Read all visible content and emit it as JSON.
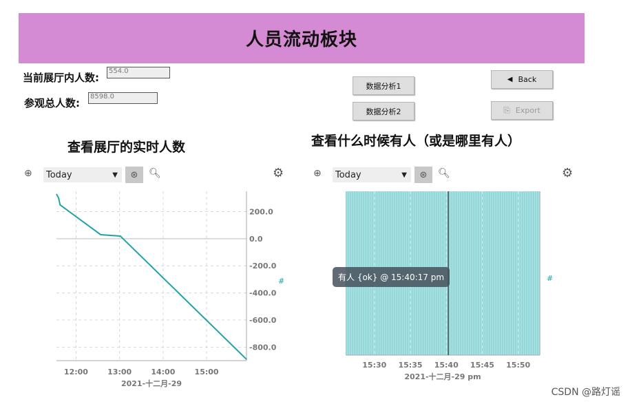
{
  "header": {
    "title": "人员流动板块"
  },
  "fields": {
    "current_label": "当前展厅内人数:",
    "current_value": "554.0",
    "total_label": "参观总人数:",
    "total_value": "8598.0"
  },
  "buttons": {
    "analysis1": "数据分析1",
    "analysis2": "数据分析2",
    "back": "Back",
    "export": "Export"
  },
  "left_panel": {
    "title": "查看展厅的实时人数",
    "range_select": "Today",
    "axis_unit": "#"
  },
  "right_panel": {
    "title": "查看什么时候有人（或是哪里有人）",
    "range_select": "Today",
    "axis_unit": "#",
    "tooltip": "有人 {ok} @ 15:40:17 pm"
  },
  "colors": {
    "banner": "#d58bd4",
    "series": "#1fa3a8",
    "strip_light": "#a9e1e2",
    "strip_dark": "#6fc9cc"
  },
  "watermark": "CSDN @路灯谣",
  "chart_data": [
    {
      "type": "line",
      "x_tick_labels": [
        "12:00",
        "13:00",
        "14:00",
        "15:00"
      ],
      "x_date_label": "2021-十二月-29",
      "y_tick_labels": [
        "200.0",
        "0.0",
        "-200.0",
        "-400.0",
        "-600.0",
        "-800.0"
      ],
      "ylim": [
        -900,
        350
      ],
      "xlim": [
        "11:33",
        "15:55"
      ],
      "series": [
        {
          "x": [
            "11:33",
            "11:36",
            "11:38",
            "12:34",
            "13:01",
            "15:55"
          ],
          "y": [
            330,
            300,
            250,
            30,
            20,
            -890
          ]
        }
      ],
      "grid": true
    },
    {
      "type": "area",
      "x_tick_labels": [
        "15:30",
        "15:35",
        "15:40",
        "15:45",
        "15:50"
      ],
      "x_date_label": "2021-十二月-29 pm",
      "xlim": [
        "15:26",
        "15:53"
      ],
      "series_label": "有人",
      "state": "ok",
      "crosshair": "15:40:17",
      "grid": true
    }
  ]
}
